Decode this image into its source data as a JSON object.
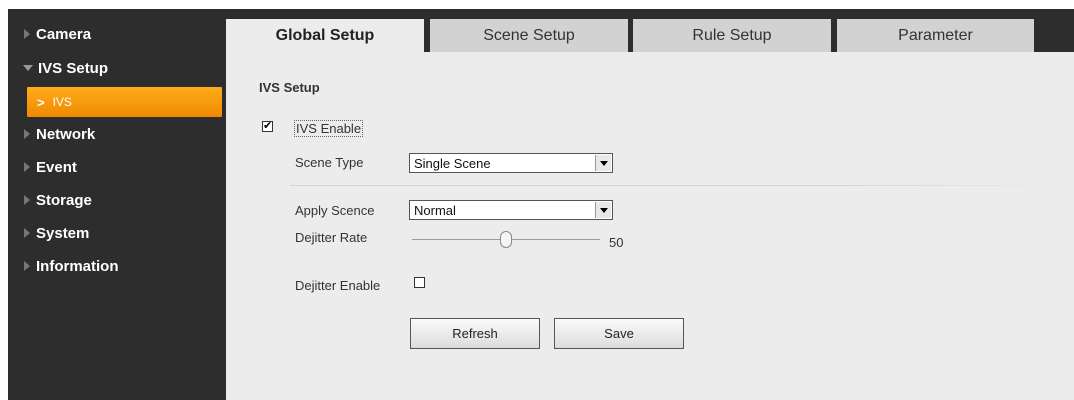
{
  "sidebar": {
    "items": [
      {
        "label": "Camera"
      },
      {
        "label": "IVS Setup"
      },
      {
        "label": "Network"
      },
      {
        "label": "Event"
      },
      {
        "label": "Storage"
      },
      {
        "label": "System"
      },
      {
        "label": "Information"
      }
    ],
    "sub_item": {
      "label": "IVS"
    }
  },
  "tabs": [
    {
      "label": "Global Setup"
    },
    {
      "label": "Scene Setup"
    },
    {
      "label": "Rule Setup"
    },
    {
      "label": "Parameter"
    }
  ],
  "form": {
    "section_title": "IVS Setup",
    "ivs_enable_label": "IVS Enable",
    "ivs_enable_checked": true,
    "scene_type_label": "Scene Type",
    "scene_type_value": "Single Scene",
    "apply_scene_label": "Apply Scence",
    "apply_scene_value": "Normal",
    "dejitter_rate_label": "Dejitter Rate",
    "dejitter_rate_value": "50",
    "dejitter_enable_label": "Dejitter Enable",
    "dejitter_enable_checked": false,
    "check_mark": "✔"
  },
  "buttons": {
    "refresh": "Refresh",
    "save": "Save"
  },
  "colors": {
    "sidebar_bg": "#2d2d2d",
    "active_nav": "#f59a10",
    "content_bg": "#ececec",
    "tab_inactive": "#d2d2d2"
  }
}
